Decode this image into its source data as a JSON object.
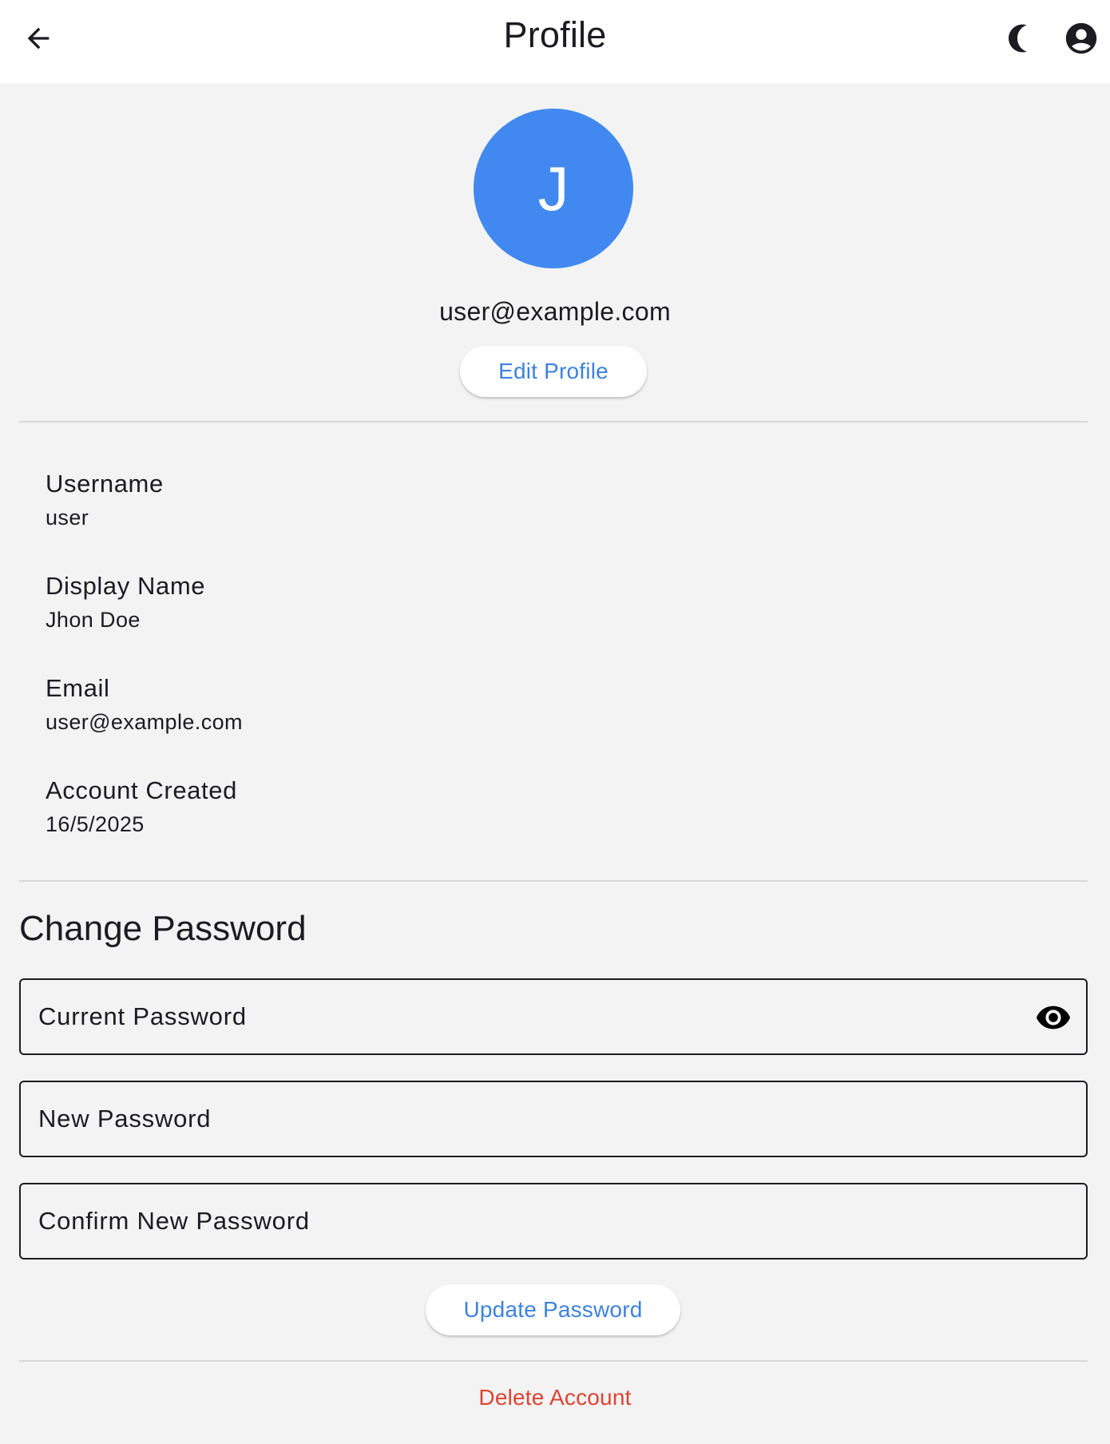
{
  "app_bar": {
    "title": "Profile",
    "icons": {
      "back": "arrow-back-icon",
      "theme": "dark-mode-moon-icon",
      "account": "account-circle-icon"
    }
  },
  "profile": {
    "avatar_initial": "J",
    "email": "user@example.com",
    "edit_label": "Edit Profile"
  },
  "info": [
    {
      "label": "Username",
      "value": "user"
    },
    {
      "label": "Display Name",
      "value": "Jhon Doe"
    },
    {
      "label": "Email",
      "value": "user@example.com"
    },
    {
      "label": "Account Created",
      "value": "16/5/2025"
    }
  ],
  "change_password": {
    "title": "Change Password",
    "current_placeholder": "Current Password",
    "new_placeholder": "New Password",
    "confirm_placeholder": "Confirm New Password",
    "update_label": "Update Password"
  },
  "delete_label": "Delete Account",
  "colors": {
    "accent": "#4189f0",
    "link": "#3d82de",
    "danger": "#dc4432",
    "background": "#f3f3f3"
  }
}
